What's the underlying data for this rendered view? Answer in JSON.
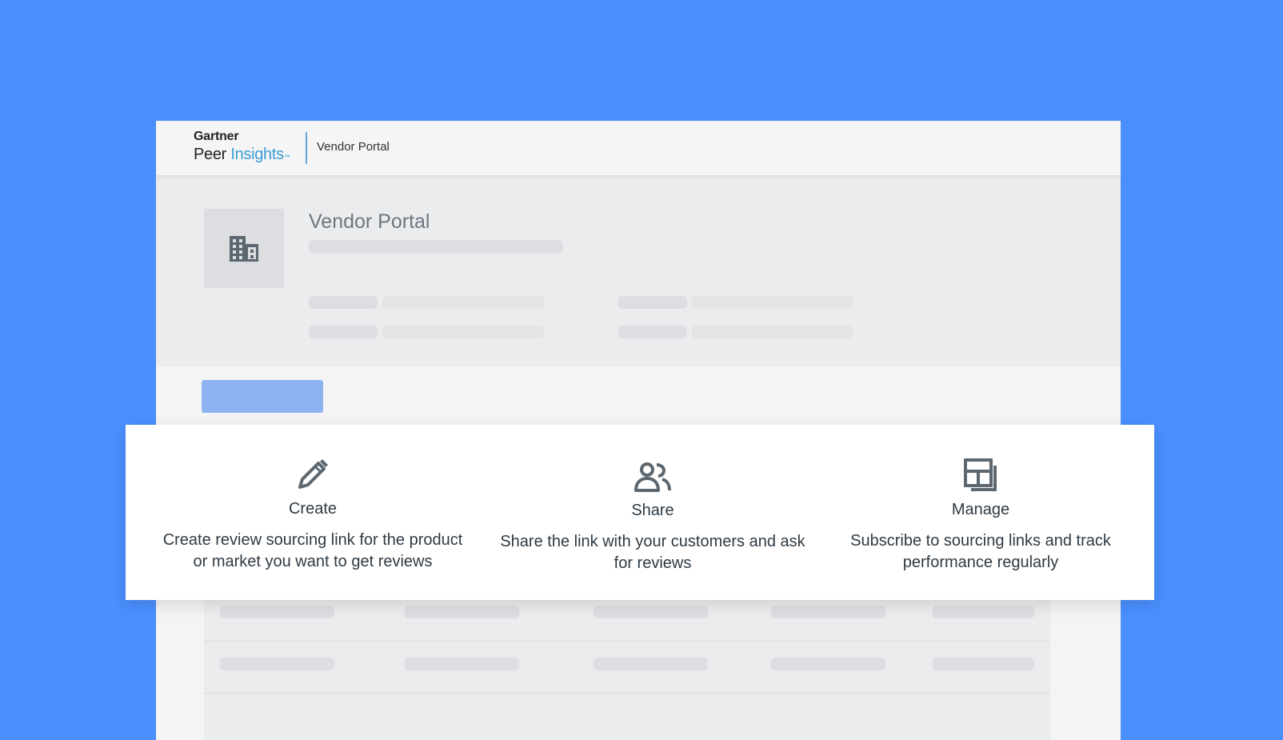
{
  "header": {
    "brand_top": "Gartner",
    "brand_peer": "Peer",
    "brand_insights": "Insights",
    "brand_tm": "™",
    "portal_label": "Vendor Portal"
  },
  "hero": {
    "title": "Vendor Portal",
    "icon": "building-icon"
  },
  "features": [
    {
      "icon": "pencil-icon",
      "title": "Create",
      "description_line1": "Create review sourcing link for the product",
      "description_line2": "or market you want to get reviews"
    },
    {
      "icon": "users-icon",
      "title": "Share",
      "description_line1": "Share the link with your customers and ask",
      "description_line2": "for reviews"
    },
    {
      "icon": "dashboard-icon",
      "title": "Manage",
      "description_line1": "Subscribe to sourcing links and track",
      "description_line2": "performance regularly"
    }
  ],
  "colors": {
    "background": "#4a8ffd",
    "brand_accent": "#3a9bd6",
    "primary_button": "#8db3f3",
    "icon_gray": "#5c6770"
  }
}
